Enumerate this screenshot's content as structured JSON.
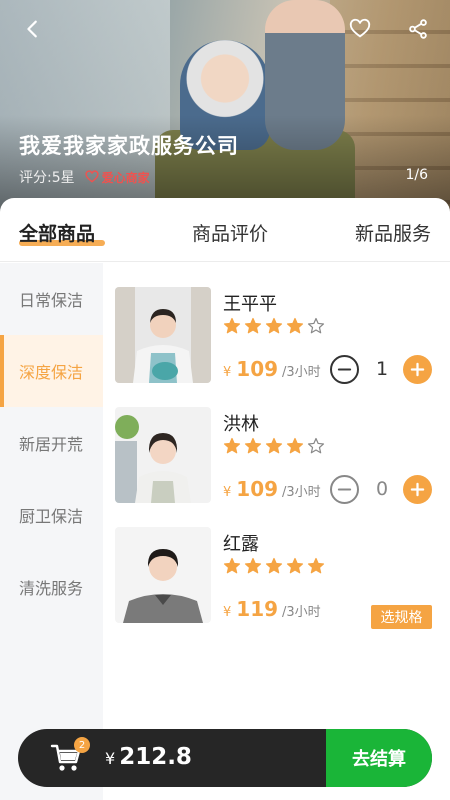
{
  "header": {
    "company_name": "我爱我家家政服务公司",
    "rating_text": "评分:5星",
    "merchant_badge": "爱心商家",
    "image_counter": "1/6"
  },
  "tabs": [
    {
      "label": "全部商品",
      "active": true
    },
    {
      "label": "商品评价",
      "active": false
    },
    {
      "label": "新品服务",
      "active": false
    }
  ],
  "sidebar": {
    "items": [
      {
        "label": "日常保洁",
        "active": false
      },
      {
        "label": "深度保洁",
        "active": true
      },
      {
        "label": "新居开荒",
        "active": false
      },
      {
        "label": "厨卫保洁",
        "active": false
      },
      {
        "label": "清洗服务",
        "active": false
      }
    ]
  },
  "products": [
    {
      "name": "王平平",
      "stars": 4,
      "max_stars": 5,
      "currency": "¥",
      "price": "109",
      "unit": "/3小时",
      "quantity": "1"
    },
    {
      "name": "洪林",
      "stars": 4,
      "max_stars": 5,
      "currency": "¥",
      "price": "109",
      "unit": "/3小时",
      "quantity": "0"
    },
    {
      "name": "红露",
      "stars": 5,
      "max_stars": 5,
      "currency": "¥",
      "price": "119",
      "unit": "/3小时",
      "action_label": "选规格"
    }
  ],
  "cart": {
    "badge_count": "2",
    "currency": "¥",
    "total": "212.8",
    "checkout_label": "去结算"
  },
  "colors": {
    "accent": "#f5a443",
    "checkout_green": "#1ab538",
    "cart_bar": "#262626"
  }
}
